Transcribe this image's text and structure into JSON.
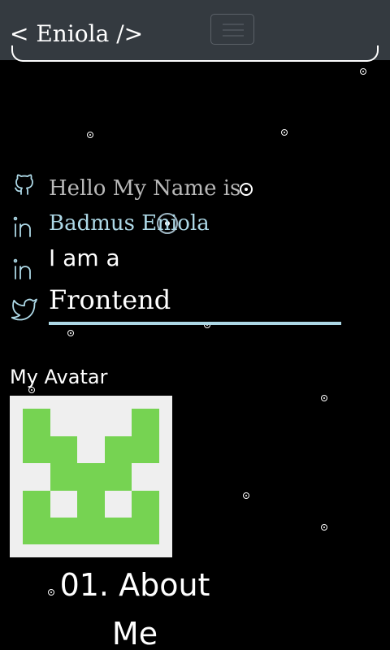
{
  "navbar": {
    "brand": "< Eniola />",
    "toggler_icon": "hamburger-icon"
  },
  "social_icons": [
    "github-icon",
    "linkedin-icon",
    "linkedin-icon",
    "twitter-icon"
  ],
  "hero": {
    "greeting": "Hello My Name is",
    "name": "Badmus Eniola",
    "intro": "I am a",
    "role": "Frontend"
  },
  "avatar": {
    "title": "My Avatar",
    "colors": {
      "background": "#efefef",
      "foreground": "#76d352"
    }
  },
  "about": {
    "heading": "01. About Me"
  },
  "colors": {
    "navbar_bg": "#343a40",
    "page_bg": "#000000",
    "accent": "#add8e6",
    "muted_text": "#b9b9b9"
  }
}
